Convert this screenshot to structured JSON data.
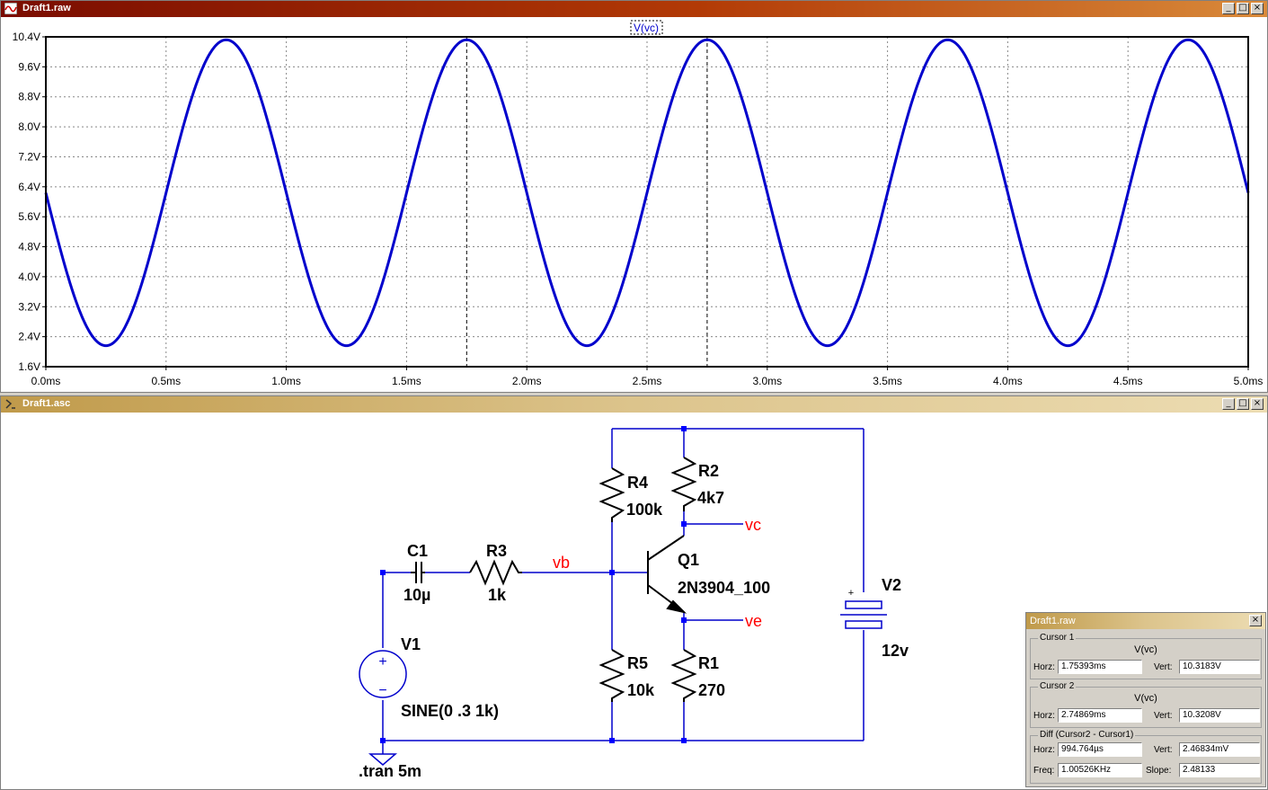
{
  "waveform_window": {
    "title": "Draft1.raw",
    "trace_label": "V(vc)",
    "buttons": {
      "minimize": "_",
      "maximize": "□",
      "close": "×"
    }
  },
  "schematic_window": {
    "title": "Draft1.asc",
    "buttons": {
      "minimize": "_",
      "maximize": "□",
      "close": "×"
    }
  },
  "chart_data": {
    "type": "line",
    "series": [
      {
        "name": "V(vc)",
        "color": "#0000cc",
        "offset_v": 6.24,
        "amplitude_v": 4.08,
        "freq_khz": 1.0,
        "t_ms": [
          0,
          5
        ],
        "shape": "-sin"
      }
    ],
    "x_ticks": [
      "0.0ms",
      "0.5ms",
      "1.0ms",
      "1.5ms",
      "2.0ms",
      "2.5ms",
      "3.0ms",
      "3.5ms",
      "4.0ms",
      "4.5ms",
      "5.0ms"
    ],
    "y_ticks": [
      "10.4V",
      "9.6V",
      "8.8V",
      "8.0V",
      "7.2V",
      "6.4V",
      "5.6V",
      "4.8V",
      "4.0V",
      "3.2V",
      "2.4V",
      "1.6V"
    ],
    "xlim_ms": [
      0,
      5
    ],
    "ylim_v": [
      1.6,
      10.4
    ],
    "cursors_ms": [
      1.75,
      2.75
    ],
    "grid": true
  },
  "schematic": {
    "labels": {
      "c1_name": "C1",
      "c1_value": "10µ",
      "r3_name": "R3",
      "r3_value": "1k",
      "r4_name": "R4",
      "r4_value": "100k",
      "r2_name": "R2",
      "r2_value": "4k7",
      "r5_name": "R5",
      "r5_value": "10k",
      "r1_name": "R1",
      "r1_value": "270",
      "q1_name": "Q1",
      "q1_model": "2N3904_100",
      "v1_name": "V1",
      "v1_value": "SINE(0 .3 1k)",
      "v2_name": "V2",
      "v2_value": "12v",
      "net_vb": "vb",
      "net_vc": "vc",
      "net_ve": "ve",
      "tran": ".tran 5m",
      "plus": "+",
      "minus": "−"
    },
    "colors": {
      "wire": "#0000cc",
      "component": "#000000",
      "net": "#ff0000",
      "junction": "#0000ff"
    }
  },
  "cursor_panel": {
    "title": "Draft1.raw",
    "close": "×",
    "cursor1": {
      "group": "Cursor 1",
      "trace": "V(vc)",
      "horz_label": "Horz:",
      "horz": "1.75393ms",
      "vert_label": "Vert:",
      "vert": "10.3183V"
    },
    "cursor2": {
      "group": "Cursor 2",
      "trace": "V(vc)",
      "horz_label": "Horz:",
      "horz": "2.74869ms",
      "vert_label": "Vert:",
      "vert": "10.3208V"
    },
    "diff": {
      "group": "Diff (Cursor2 - Cursor1)",
      "horz_label": "Horz:",
      "horz": "994.764µs",
      "vert_label": "Vert:",
      "vert": "2.46834mV",
      "freq_label": "Freq:",
      "freq": "1.00526KHz",
      "slope_label": "Slope:",
      "slope": "2.48133"
    }
  }
}
